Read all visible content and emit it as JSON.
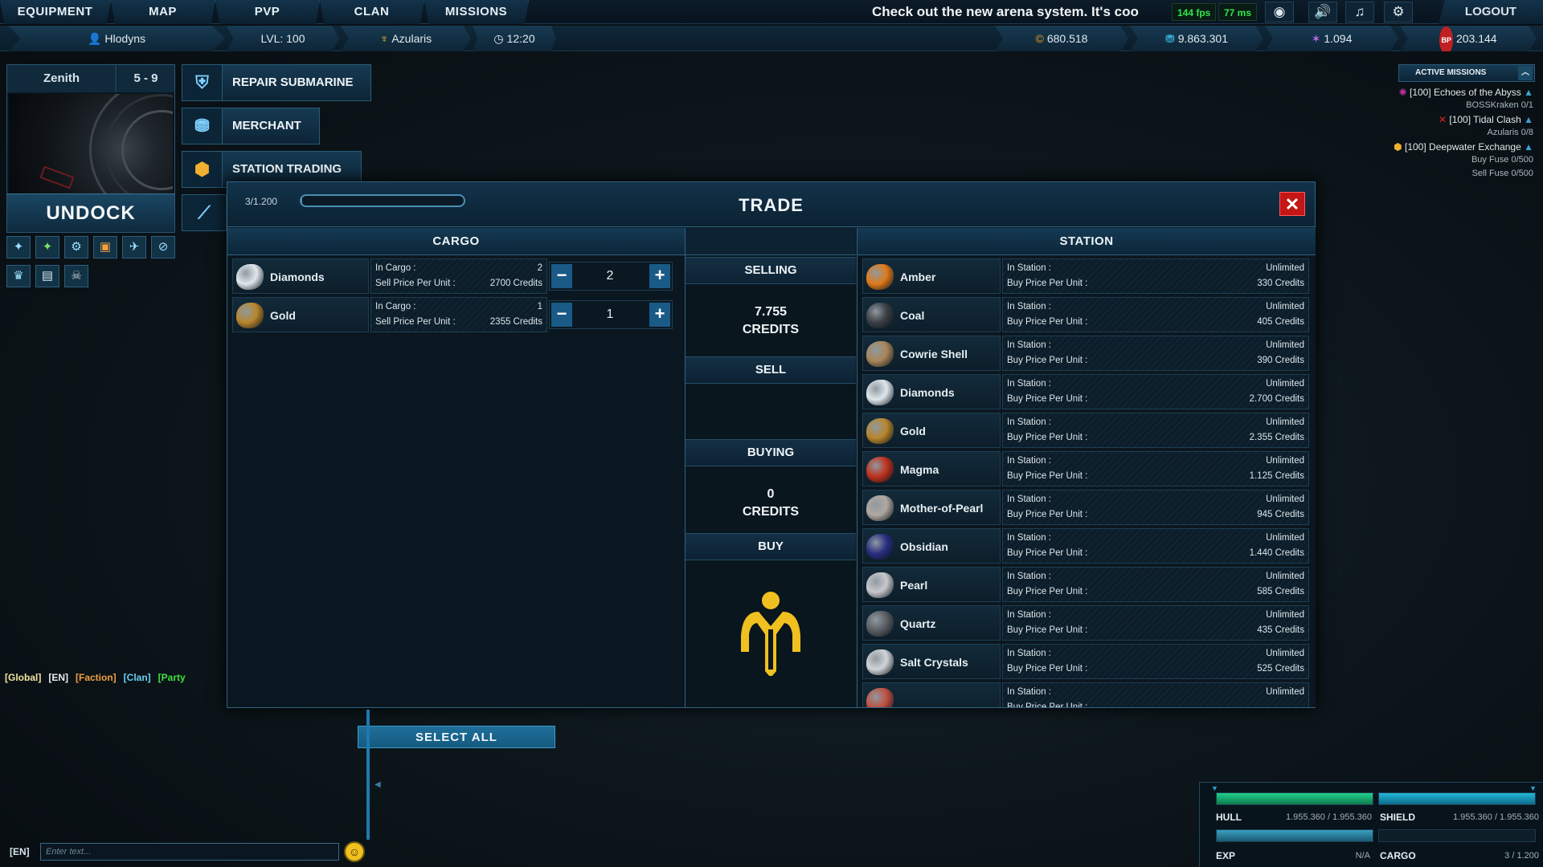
{
  "nav": {
    "items": [
      "EQUIPMENT",
      "MAP",
      "PVP",
      "CLAN",
      "MISSIONS"
    ],
    "ticker": "Check out the new arena system. It's coo",
    "fps": "144 fps",
    "ping": "77 ms",
    "logout": "LOGOUT"
  },
  "status": {
    "player": "Hlodyns",
    "level": "LVL: 100",
    "faction": "Azularis",
    "time": "12:20",
    "currency1": "680.518",
    "currency2": "9.863.301",
    "currency3": "1.094",
    "bp": "203.144",
    "bp_label": "BP"
  },
  "station": {
    "name": "Zenith",
    "sector": "5 - 9",
    "undock": "UNDOCK"
  },
  "actions": {
    "repair": "REPAIR SUBMARINE",
    "merchant": "MERCHANT",
    "trading": "STATION TRADING"
  },
  "missions": {
    "header": "ACTIVE MISSIONS",
    "list": [
      {
        "title": "[100] Echoes of the Abyss",
        "sub": [
          "BOSSKraken 0/1"
        ]
      },
      {
        "title": "[100] Tidal Clash",
        "sub": [
          "Azularis 0/8"
        ]
      },
      {
        "title": "[100] Deepwater Exchange",
        "sub": [
          "Buy Fuse 0/500",
          "Sell Fuse 0/500"
        ]
      }
    ]
  },
  "trade": {
    "title": "TRADE",
    "capacity": "3/1.200",
    "capacity_fill": 0.0025,
    "close": "✕",
    "cargo_header": "CARGO",
    "station_header": "STATION",
    "selling_label": "SELLING",
    "selling_amount": "7.755",
    "credits_label": "CREDITS",
    "sell_btn": "SELL",
    "buying_label": "BUYING",
    "buying_amount": "0",
    "buy_btn": "BUY",
    "select_all": "SELECT ALL",
    "in_cargo_label": "In Cargo :",
    "sell_price_label": "Sell Price Per Unit :",
    "in_station_label": "In Station :",
    "buy_price_label": "Buy Price Per Unit :",
    "cargo_items": [
      {
        "name": "Diamonds",
        "count": "2",
        "price": "2700 Credits",
        "qty": "2",
        "color": "#dfe7ec"
      },
      {
        "name": "Gold",
        "count": "1",
        "price": "2355 Credits",
        "qty": "1",
        "color": "#b8862c"
      }
    ],
    "station_items": [
      {
        "name": "Amber",
        "stock": "Unlimited",
        "price": "330 Credits",
        "color": "#e07a1a"
      },
      {
        "name": "Coal",
        "stock": "Unlimited",
        "price": "405 Credits",
        "color": "#3a4046"
      },
      {
        "name": "Cowrie Shell",
        "stock": "Unlimited",
        "price": "390 Credits",
        "color": "#a8865a"
      },
      {
        "name": "Diamonds",
        "stock": "Unlimited",
        "price": "2.700 Credits",
        "color": "#dfe7ec"
      },
      {
        "name": "Gold",
        "stock": "Unlimited",
        "price": "2.355 Credits",
        "color": "#b8862c"
      },
      {
        "name": "Magma",
        "stock": "Unlimited",
        "price": "1.125 Credits",
        "color": "#c0321e"
      },
      {
        "name": "Mother-of-Pearl",
        "stock": "Unlimited",
        "price": "945 Credits",
        "color": "#b0a8a0"
      },
      {
        "name": "Obsidian",
        "stock": "Unlimited",
        "price": "1.440 Credits",
        "color": "#2a2e80"
      },
      {
        "name": "Pearl",
        "stock": "Unlimited",
        "price": "585 Credits",
        "color": "#c8c8cc"
      },
      {
        "name": "Quartz",
        "stock": "Unlimited",
        "price": "435 Credits",
        "color": "#5a5e64"
      },
      {
        "name": "Salt Crystals",
        "stock": "Unlimited",
        "price": "525 Credits",
        "color": "#d0d4d8"
      },
      {
        "name": "",
        "stock": "Unlimited",
        "price": "",
        "color": "#c05040"
      }
    ]
  },
  "chat": {
    "tabs": [
      {
        "label": "[Global]",
        "color": "#f0e6a0"
      },
      {
        "label": "[EN]",
        "color": "#e8eef0"
      },
      {
        "label": "[Faction]",
        "color": "#f0a040"
      },
      {
        "label": "[Clan]",
        "color": "#6ad0f0"
      },
      {
        "label": "[Party",
        "color": "#40e040"
      }
    ],
    "lang": "[EN]",
    "placeholder": "Enter text..."
  },
  "ship": {
    "hull_label": "HULL",
    "hull_value": "1.955.360 / 1.955.360",
    "shield_label": "SHIELD",
    "shield_value": "1.955.360 / 1.955.360",
    "exp_label": "EXP",
    "exp_value": "N/A",
    "cargo_label": "CARGO",
    "cargo_value": "3 / 1.200"
  }
}
